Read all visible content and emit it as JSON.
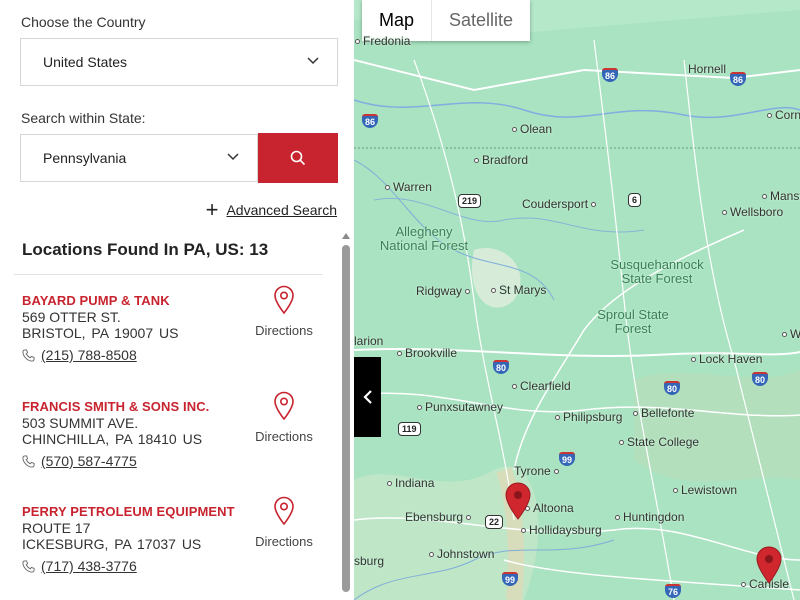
{
  "country": {
    "label": "Choose the Country",
    "value": "United States"
  },
  "state": {
    "label": "Search within State:",
    "value": "Pennsylvania"
  },
  "advanced": {
    "label": "Advanced Search"
  },
  "results": {
    "heading": "Locations Found In PA, US: 13"
  },
  "locations": [
    {
      "name": "BAYARD PUMP & TANK",
      "street": "569 OTTER ST.",
      "citystate": "BRISTOL,  PA  19007  US",
      "phone": "(215) 788-8508",
      "directions": "Directions"
    },
    {
      "name": "FRANCIS SMITH & SONS INC.",
      "street": "503 SUMMIT AVE.",
      "citystate": "CHINCHILLA,  PA  18410  US",
      "phone": "(570) 587-4775",
      "directions": "Directions"
    },
    {
      "name": "PERRY PETROLEUM EQUIPMENT",
      "street": "ROUTE 17",
      "citystate": "ICKESBURG,  PA  17037  US",
      "phone": "(717) 438-3776",
      "directions": "Directions"
    }
  ],
  "map": {
    "types": {
      "map": "Map",
      "satellite": "Satellite"
    },
    "places": {
      "fredonia": "Fredonia",
      "hornell": "Hornell",
      "corni": "Corni",
      "olean": "Olean",
      "bradford": "Bradford",
      "warren": "Warren",
      "coudersport": "Coudersport",
      "mansf": "Mansf",
      "wellsboro": "Wellsboro",
      "allegheny": "Allegheny National Forest",
      "susquehannock": "Susquehannock State Forest",
      "ridgway": "Ridgway",
      "stmarys": "St Marys",
      "sproul": "Sproul State Forest",
      "larion": "larion",
      "wille": "Wil",
      "brookville": "Brookville",
      "lockhaven": "Lock Haven",
      "clearfield": "Clearfield",
      "punxsutawney": "Punxsutawney",
      "philipsburg": "Philipsburg",
      "bellefonte": "Bellefonte",
      "statecollege": "State College",
      "tyrone": "Tyrone",
      "indiana": "Indiana",
      "lewistown": "Lewistown",
      "altoona": "Altoona",
      "ebensburg": "Ebensburg",
      "hollidaysburg": "Hollidaysburg",
      "huntingdon": "Huntingdon",
      "johnstown": "Johnstown",
      "sburg": "sburg",
      "carlisle": "Carlisle"
    },
    "routes": {
      "r86a": "86",
      "r86b": "86",
      "r86c": "86",
      "r219": "219",
      "r6": "6",
      "r80a": "80",
      "r80b": "80",
      "r80c": "80",
      "r119": "119",
      "r99a": "99",
      "r22": "22",
      "r99b": "99",
      "r76": "76"
    }
  }
}
